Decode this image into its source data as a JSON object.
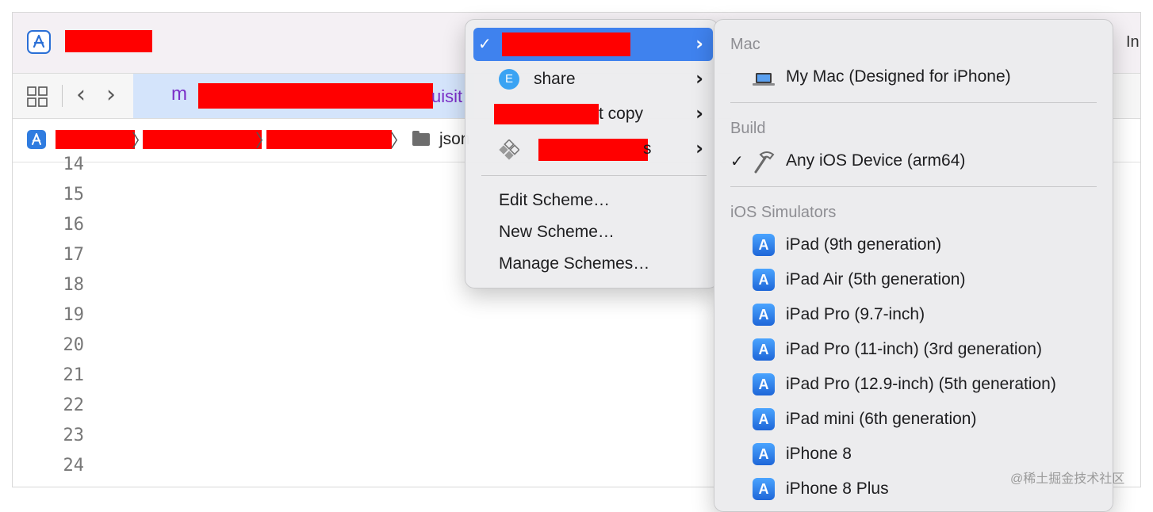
{
  "toolbar": {
    "app_icon": "app-store-icon",
    "right_text": "In"
  },
  "tabbar": {
    "tab_icon_letter": "m",
    "tab_fragment": "uisit",
    "back_label": "‹",
    "forward_label": "›"
  },
  "breadcrumb": {
    "folder_label": "json"
  },
  "editor": {
    "line_numbers": [
      "14",
      "15",
      "16",
      "17",
      "18",
      "19",
      "20",
      "21",
      "22",
      "23",
      "24"
    ]
  },
  "scheme_menu": {
    "items": [
      {
        "label": "",
        "checked": true,
        "has_submenu": true
      },
      {
        "label": "share",
        "badge": "E",
        "has_submenu": true
      },
      {
        "label": "t copy",
        "has_submenu": true
      },
      {
        "label": "s",
        "has_submenu": true
      }
    ],
    "actions": [
      "Edit Scheme…",
      "New Scheme…",
      "Manage Schemes…"
    ]
  },
  "destination_menu": {
    "sections": {
      "mac": "Mac",
      "build": "Build",
      "simulators": "iOS Simulators"
    },
    "mac_device": "My Mac (Designed for iPhone)",
    "build_device": "Any iOS Device (arm64)",
    "simulators": [
      "iPad (9th generation)",
      "iPad Air (5th generation)",
      "iPad Pro (9.7-inch)",
      "iPad Pro (11-inch) (3rd generation)",
      "iPad Pro (12.9-inch) (5th generation)",
      "iPad mini (6th generation)",
      "iPhone 8",
      "iPhone 8 Plus"
    ]
  },
  "watermark": "@稀土掘金技术社区",
  "colors": {
    "accent": "#3f82ee",
    "redaction": "#ff0000",
    "tab_active": "#d4e4fb"
  }
}
